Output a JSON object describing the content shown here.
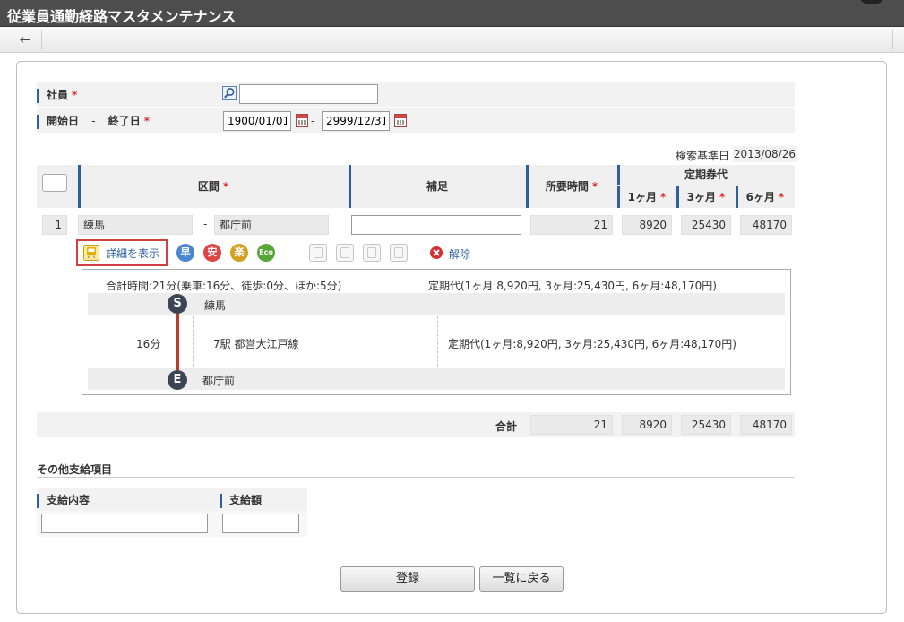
{
  "window": {
    "title": "従業員通勤経路マスタメンテナンス"
  },
  "toolbar": {
    "back_icon": "←"
  },
  "form": {
    "employee": {
      "label": "社員",
      "required": "*",
      "value": "",
      "search_icon": "magnifier-icon"
    },
    "period": {
      "label_start": "開始日",
      "separator": "-",
      "label_end": "終了日",
      "required": "*",
      "start": "1900/01/01",
      "end": "2999/12/31",
      "range_sep": "-"
    },
    "base_date": {
      "label": "検索基準日",
      "value": "2013/08/26"
    }
  },
  "route_table": {
    "headers": {
      "section": "区間",
      "supplement": "補足",
      "time": "所要時間",
      "pass": "定期券代",
      "m1": "1ヶ月",
      "m3": "3ヶ月",
      "m6": "6ヶ月",
      "required": "*"
    },
    "row": {
      "no": "1",
      "from": "練馬",
      "sep": "-",
      "to": "都庁前",
      "supplement": "",
      "time": "21",
      "m1": "8920",
      "m3": "25430",
      "m6": "48170"
    },
    "actions": {
      "detail": "詳細を表示",
      "fast": "早",
      "safe": "安",
      "easy": "楽",
      "eco": "Eco",
      "remove": "解除"
    },
    "detail": {
      "summary_time": "合計時間:21分(乗車:16分、徒歩:0分、ほか:5分)",
      "summary_pass": "定期代(1ヶ月:8,920円, 3ヶ月:25,430円, 6ヶ月:48,170円)",
      "start_mark": "S",
      "start_station": "練馬",
      "duration": "16分",
      "line": "7駅  都営大江戸線",
      "line_pass": "定期代(1ヶ月:8,920円, 3ヶ月:25,430円, 6ヶ月:48,170円)",
      "end_mark": "E",
      "end_station": "都庁前"
    },
    "total": {
      "label": "合計",
      "time": "21",
      "m1": "8920",
      "m3": "25430",
      "m6": "48170"
    }
  },
  "other": {
    "title": "その他支給項目",
    "content_label": "支給内容",
    "amount_label": "支給額",
    "content_value": "",
    "amount_value": ""
  },
  "buttons": {
    "register": "登録",
    "back_to_list": "一覧に戻る"
  },
  "colors": {
    "accent": "#2f5f9e",
    "required": "#e03030",
    "fast": "#4a86d4",
    "safe": "#e04545",
    "easy": "#d4a020",
    "eco": "#55a838"
  }
}
